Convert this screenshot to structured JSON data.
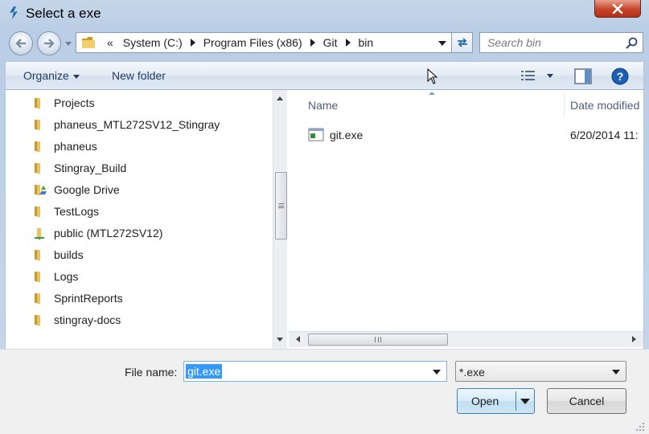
{
  "window": {
    "title": "Select a exe",
    "close_label": "×"
  },
  "navbar": {
    "address_prefix": "«",
    "path": [
      "System (C:)",
      "Program Files (x86)",
      "Git",
      "bin"
    ],
    "search_placeholder": "Search bin"
  },
  "toolbar": {
    "organize_label": "Organize",
    "new_folder_label": "New folder",
    "views_icon": "details-view-icon",
    "preview_icon": "preview-pane-icon",
    "help_icon": "help-icon"
  },
  "nav_pane": {
    "items": [
      {
        "label": "Projects",
        "icon": "folder-icon"
      },
      {
        "label": "phaneus_MTL272SV12_Stingray",
        "icon": "folder-icon"
      },
      {
        "label": "phaneus",
        "icon": "folder-icon"
      },
      {
        "label": "Stingray_Build",
        "icon": "folder-icon"
      },
      {
        "label": "Google Drive",
        "icon": "google-drive-folder-icon"
      },
      {
        "label": "TestLogs",
        "icon": "folder-icon"
      },
      {
        "label": "public (MTL272SV12)",
        "icon": "shared-folder-icon"
      },
      {
        "label": "builds",
        "icon": "folder-icon"
      },
      {
        "label": "Logs",
        "icon": "folder-icon"
      },
      {
        "label": "SprintReports",
        "icon": "folder-icon"
      },
      {
        "label": "stingray-docs",
        "icon": "folder-icon"
      }
    ]
  },
  "file_list": {
    "columns": [
      "Name",
      "Date modified"
    ],
    "rows": [
      {
        "name": "git.exe",
        "date_modified": "6/20/2014 11:",
        "icon": "exe-file-icon"
      }
    ]
  },
  "bottom": {
    "file_name_label": "File name:",
    "file_name_value": "git.exe",
    "file_type_value": "*.exe",
    "open_label": "Open",
    "cancel_label": "Cancel"
  },
  "colors": {
    "selection": "#3399ff",
    "close_button": "#c7432a",
    "folder": "#e8c15a"
  }
}
